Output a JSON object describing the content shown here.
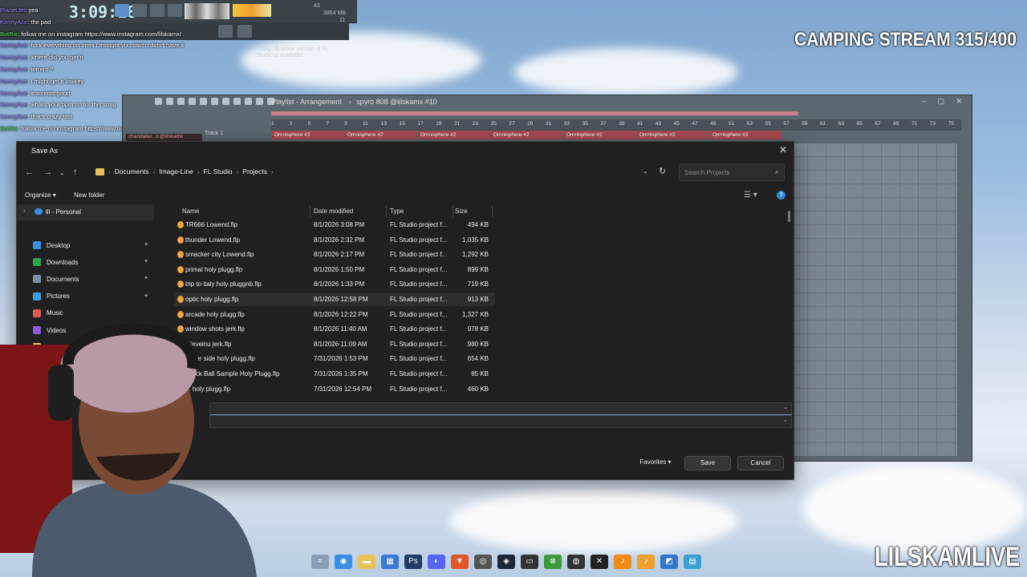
{
  "fl": {
    "clock": "3:09:18",
    "stats_line1": "43",
    "stats_line2": "3864 MB",
    "stats_line3": "11",
    "update_hint": "Today: A newer version of FL Studio is available!"
  },
  "chat": [
    {
      "user": "PlanetJet",
      "msg": "yea",
      "kind": "user"
    },
    {
      "user": "KennyAce",
      "msg": "the pad",
      "kind": "user"
    },
    {
      "user": "BotRix",
      "msg": "follow me on instagram https://www.instagram.com/lilskamx/",
      "kind": "bot"
    },
    {
      "user": "KennyAce",
      "msg": "fuck everything on omni I thought you said u didn't have it",
      "kind": "user"
    },
    {
      "user": "KennyAce",
      "msg": "where did you get it",
      "kind": "user"
    },
    {
      "user": "KennyAce",
      "msg": "torrent ?",
      "kind": "user"
    },
    {
      "user": "KennyAce",
      "msg": "I might get it lowkey",
      "kind": "user"
    },
    {
      "user": "KennyAce",
      "msg": "it sounds good",
      "kind": "user"
    },
    {
      "user": "KennyAce",
      "msg": "whats your bpm on for this song",
      "kind": "user"
    },
    {
      "user": "KennyAce",
      "msg": "that's crazy fast",
      "kind": "user"
    },
    {
      "user": "BotRix",
      "msg": "follow me on instagram https://www.instagram.com/lilskamx/",
      "kind": "bot"
    }
  ],
  "stream": {
    "title": "CAMPING STREAM 315/400",
    "brand": "LILSKAMLIVE"
  },
  "playlist": {
    "title": "Playlist - Arrangement",
    "pattern": "spyro 808 @lilskamx #10",
    "track_label": "Track 1",
    "chandelier": "chandalier...t @lilskamx",
    "ruler": [
      "1",
      "3",
      "5",
      "7",
      "9",
      "11",
      "13",
      "15",
      "17",
      "19",
      "21",
      "23",
      "25",
      "27",
      "29",
      "31",
      "33",
      "35",
      "37",
      "39",
      "41",
      "43",
      "45",
      "47",
      "49",
      "51",
      "53",
      "55",
      "57",
      "59",
      "61",
      "63",
      "65",
      "67",
      "69",
      "71",
      "73",
      "75"
    ],
    "clip_label": "Omnisphere #2",
    "clip_count": 7
  },
  "dialog": {
    "title": "Save As",
    "breadcrumb": [
      "Documents",
      "Image-Line",
      "FL Studio",
      "Projects"
    ],
    "search_placeholder": "Search Projects",
    "organize_label": "Organize",
    "new_folder_label": "New folder",
    "nav_onedrive": "lil - Personal",
    "nav_items": [
      {
        "label": "Desktop",
        "color": "#3a8ee6"
      },
      {
        "label": "Downloads",
        "color": "#2fa84f"
      },
      {
        "label": "Documents",
        "color": "#7d8fa8"
      },
      {
        "label": "Pictures",
        "color": "#3aa0e0"
      },
      {
        "label": "Music",
        "color": "#e05a5a"
      },
      {
        "label": "Videos",
        "color": "#8a5ae0"
      },
      {
        "label": "Ma",
        "color": "#e8c35a"
      }
    ],
    "columns": {
      "name": "Name",
      "date": "Date modified",
      "type": "Type",
      "size": "Size"
    },
    "files": [
      {
        "name": "TR666 Lowend.flp",
        "date": "8/1/2026 3:08 PM",
        "type": "FL Studio project f...",
        "size": "494 KB"
      },
      {
        "name": "thunder Lowend.flp",
        "date": "8/1/2026 2:32 PM",
        "type": "FL Studio project f...",
        "size": "1,035 KB"
      },
      {
        "name": "smacker city Lowend.flp",
        "date": "8/1/2026 2:17 PM",
        "type": "FL Studio project f...",
        "size": "1,292 KB"
      },
      {
        "name": "primal holy plugg.flp",
        "date": "8/1/2026 1:50 PM",
        "type": "FL Studio project f...",
        "size": "899 KB"
      },
      {
        "name": "trip to italy holy pluggnb.flp",
        "date": "8/1/2026 1:33 PM",
        "type": "FL Studio project f...",
        "size": "719 KB"
      },
      {
        "name": "optic holy plugg.flp",
        "date": "8/1/2026 12:58 PM",
        "type": "FL Studio project f...",
        "size": "913 KB"
      },
      {
        "name": "arcade holy plugg.flp",
        "date": "8/1/2026 12:22 PM",
        "type": "FL Studio project f...",
        "size": "1,327 KB"
      },
      {
        "name": "window shots jerk.flp",
        "date": "8/1/2026 11:40 AM",
        "type": "FL Studio project f...",
        "size": "978 KB"
      },
      {
        "name": "elieveinu jerk.flp",
        "date": "8/1/2026 11:09 AM",
        "type": "FL Studio project f...",
        "size": "980 KB"
      },
      {
        "name": "ot...er side holy plugg.flp",
        "date": "7/31/2026 1:53 PM",
        "type": "FL Studio project f...",
        "size": "654 KB"
      },
      {
        "name": "...lock Ball Sample Holy Plugg.flp",
        "date": "7/31/2026 1:35 PM",
        "type": "FL Studio project f...",
        "size": "85 KB"
      },
      {
        "name": "... holy plugg.flp",
        "date": "7/31/2026 12:54 PM",
        "type": "FL Studio project f...",
        "size": "460 KB"
      }
    ],
    "favorites_label": "Favorites",
    "save_label": "Save",
    "cancel_label": "Cancel"
  },
  "taskbar": [
    {
      "name": "widgets-icon",
      "color": "#8aa0b8",
      "glyph": "≈"
    },
    {
      "name": "chrome-icon",
      "color": "#3a8ee6",
      "glyph": "◉"
    },
    {
      "name": "file-explorer-icon",
      "color": "#e8c35a",
      "glyph": "▬"
    },
    {
      "name": "store-icon",
      "color": "#3a7ad6",
      "glyph": "▦"
    },
    {
      "name": "photoshop-icon",
      "color": "#1f3b66",
      "glyph": "Ps"
    },
    {
      "name": "discord-icon",
      "color": "#5865f2",
      "glyph": "◐"
    },
    {
      "name": "brave-icon",
      "color": "#e0582a",
      "glyph": "▼"
    },
    {
      "name": "obs-icon",
      "color": "#555",
      "glyph": "◎"
    },
    {
      "name": "steam-icon",
      "color": "#1b2838",
      "glyph": "◈"
    },
    {
      "name": "app-icon",
      "color": "#333",
      "glyph": "▭"
    },
    {
      "name": "xbox-icon",
      "color": "#3a9a3a",
      "glyph": "⊗"
    },
    {
      "name": "app2-icon",
      "color": "#333",
      "glyph": "◍"
    },
    {
      "name": "capcut-icon",
      "color": "#222",
      "glyph": "✕"
    },
    {
      "name": "fl-studio-icon",
      "color": "#f08a1a",
      "glyph": "♪"
    },
    {
      "name": "fl-studio-active-icon",
      "color": "#f0a030",
      "glyph": "♪"
    },
    {
      "name": "app3-icon",
      "color": "#2f77c9",
      "glyph": "◩"
    },
    {
      "name": "notepad-icon",
      "color": "#3aa0d0",
      "glyph": "▤"
    }
  ]
}
